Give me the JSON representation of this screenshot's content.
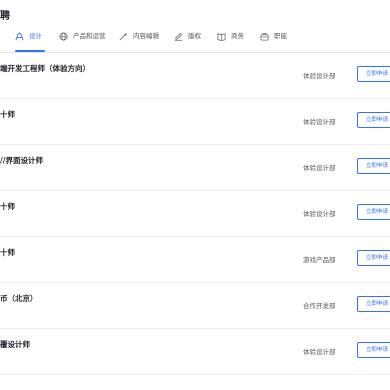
{
  "header": {
    "title": "聘"
  },
  "tabs": [
    {
      "label": "设计",
      "icon": "design-pen-icon",
      "active": true
    },
    {
      "label": "产品和运营",
      "icon": "product-globe-icon",
      "active": false
    },
    {
      "label": "内容编辑",
      "icon": "content-sparkle-icon",
      "active": false
    },
    {
      "label": "版权",
      "icon": "copyright-edit-icon",
      "active": false
    },
    {
      "label": "商务",
      "icon": "business-book-icon",
      "active": false
    },
    {
      "label": "职能",
      "icon": "function-briefcase-icon",
      "active": false
    }
  ],
  "colors": {
    "accent": "#3370ff",
    "text": "#1f2329",
    "secondary_text": "#51565d",
    "divider": "#edeef0"
  },
  "jobs": [
    {
      "title": "端开发工程师（体验方向）",
      "dept": "体验设计部",
      "apply_label": "立即申请"
    },
    {
      "title": "十师",
      "dept": "体验设计部",
      "apply_label": "立即申请"
    },
    {
      "title": "//界面设计师",
      "dept": "体验设计部",
      "apply_label": "立即申请"
    },
    {
      "title": "十师",
      "dept": "体验设计部",
      "apply_label": "立即申请"
    },
    {
      "title": "十师",
      "dept": "游戏产品部",
      "apply_label": "立即申请"
    },
    {
      "title": "币（北京）",
      "dept": "合作开发部",
      "apply_label": "立即申请"
    },
    {
      "title": "覆设计师",
      "dept": "体验设计部",
      "apply_label": "立即申请"
    }
  ]
}
